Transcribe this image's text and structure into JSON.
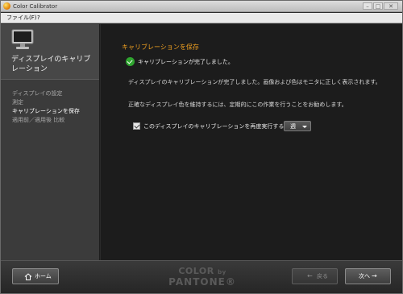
{
  "window": {
    "title": "Color Calibrator"
  },
  "menu": {
    "file": "ファイル(F)",
    "help": "?"
  },
  "sidebar": {
    "title": "ディスプレイのキャリブレーション",
    "steps": [
      {
        "label": "ディスプレイの設定",
        "active": false
      },
      {
        "label": "測定",
        "active": false
      },
      {
        "label": "キャリブレーションを保存",
        "active": true
      },
      {
        "label": "適用前／適用後 比較",
        "active": false
      }
    ]
  },
  "main": {
    "heading": "キャリブレーションを保存",
    "status": "キャリブレーションが完了しました。",
    "paragraph1": "ディスプレイのキャリブレーションが完了しました。画像および色はモニタに正しく表示されます。",
    "paragraph2": "正確なディスプレイ色を維持するには、定期的にこの作業を行うことをお勧めします。",
    "reminder_label": "このディスプレイのキャリブレーションを再度実行する通知:",
    "reminder_checked": true,
    "reminder_value": "週"
  },
  "footer": {
    "home": "ホーム",
    "back": "戻る",
    "next": "次へ",
    "brand_top": "COLOR",
    "brand_by": "by",
    "brand_bottom": "PANTONE®"
  }
}
